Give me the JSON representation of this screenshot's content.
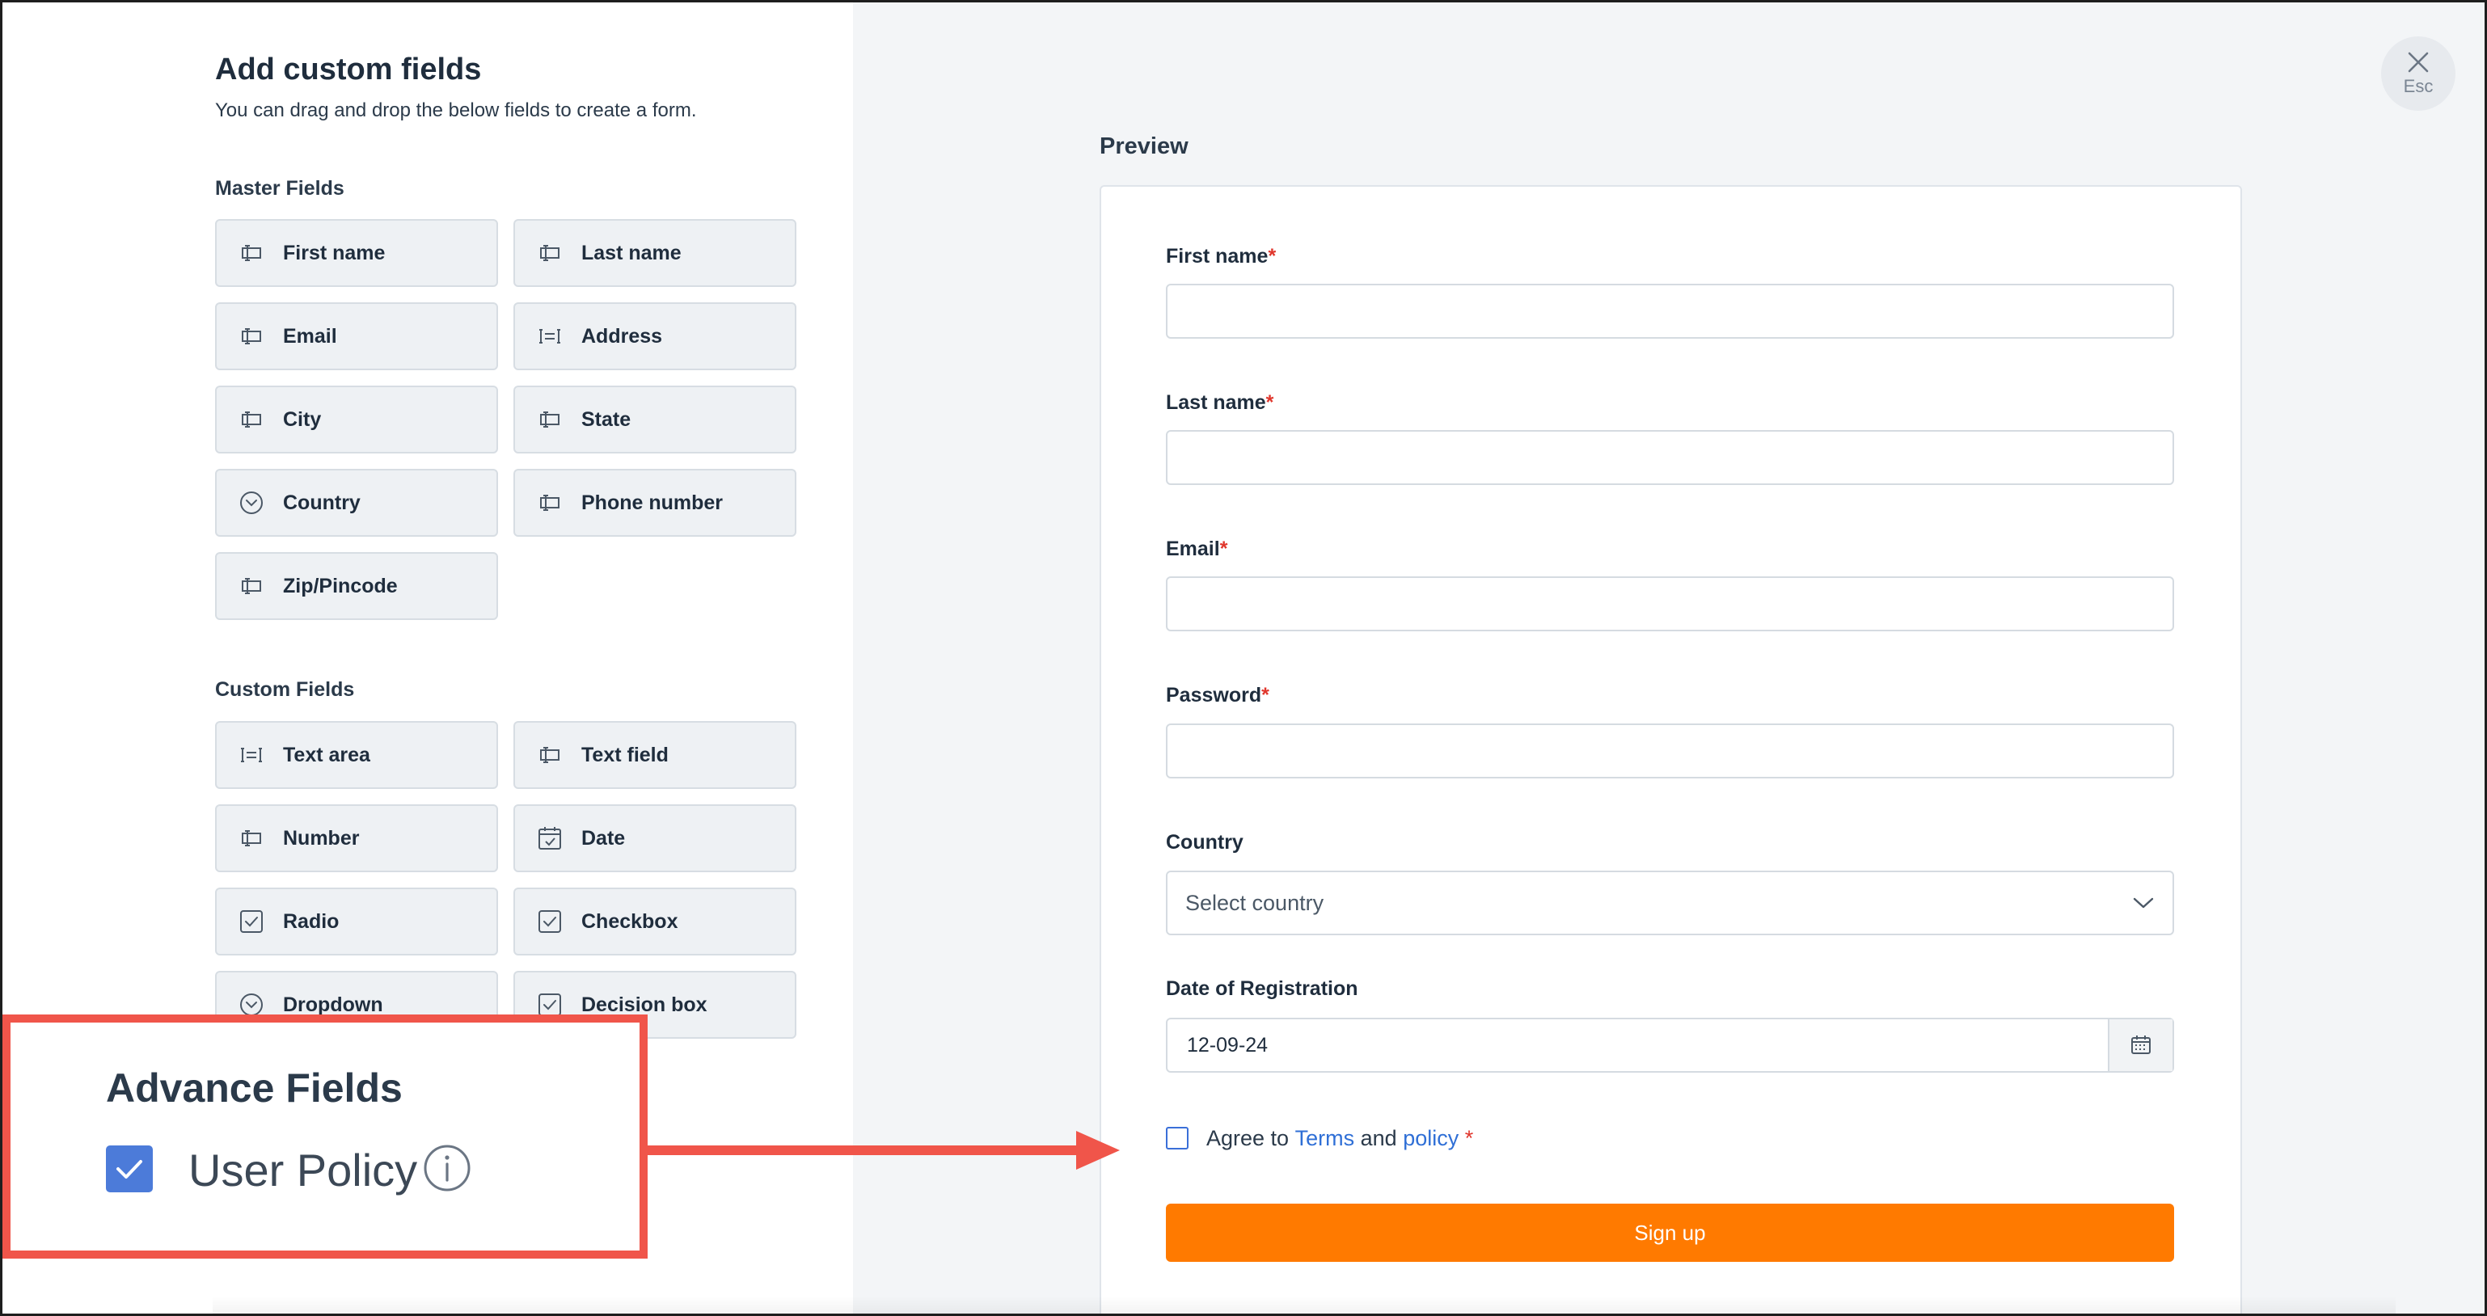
{
  "left": {
    "title": "Add custom fields",
    "subtitle": "You can drag and drop the below fields to create a form.",
    "master_label": "Master Fields",
    "master_fields": [
      {
        "label": "First name",
        "icon": "text-input-icon"
      },
      {
        "label": "Last name",
        "icon": "text-input-icon"
      },
      {
        "label": "Email",
        "icon": "text-input-icon"
      },
      {
        "label": "Address",
        "icon": "textarea-icon"
      },
      {
        "label": "City",
        "icon": "text-input-icon"
      },
      {
        "label": "State",
        "icon": "text-input-icon"
      },
      {
        "label": "Country",
        "icon": "dropdown-circle-icon"
      },
      {
        "label": "Phone number",
        "icon": "text-input-icon"
      },
      {
        "label": "Zip/Pincode",
        "icon": "text-input-icon"
      }
    ],
    "custom_label": "Custom Fields",
    "custom_fields": [
      {
        "label": "Text area",
        "icon": "textarea-icon"
      },
      {
        "label": "Text field",
        "icon": "text-input-icon"
      },
      {
        "label": "Number",
        "icon": "text-input-icon"
      },
      {
        "label": "Date",
        "icon": "calendar-icon"
      },
      {
        "label": "Radio",
        "icon": "checkbox-icon"
      },
      {
        "label": "Checkbox",
        "icon": "checkbox-icon"
      },
      {
        "label": "Dropdown",
        "icon": "dropdown-circle-icon"
      },
      {
        "label": "Decision box",
        "icon": "checkbox-icon"
      }
    ]
  },
  "close": {
    "esc_label": "Esc"
  },
  "preview": {
    "title": "Preview",
    "fields": {
      "first_name": "First name",
      "last_name": "Last name",
      "email": "Email",
      "password": "Password",
      "country": "Country",
      "date": "Date of Registration"
    },
    "required_mark": "*",
    "country_placeholder": "Select country",
    "date_value": "12-09-24",
    "agree": {
      "prefix": "Agree to",
      "terms": "Terms",
      "and": "and",
      "policy": "policy",
      "required": "*"
    },
    "signup_label": "Sign up"
  },
  "callout": {
    "title": "Advance Fields",
    "option_label": "User Policy",
    "checked": true
  },
  "colors": {
    "accent_orange": "#ff7a00",
    "link_blue": "#2f6fd6",
    "required_red": "#e0362c",
    "callout_red": "#f0554a",
    "checkbox_blue": "#4c7bd9"
  }
}
